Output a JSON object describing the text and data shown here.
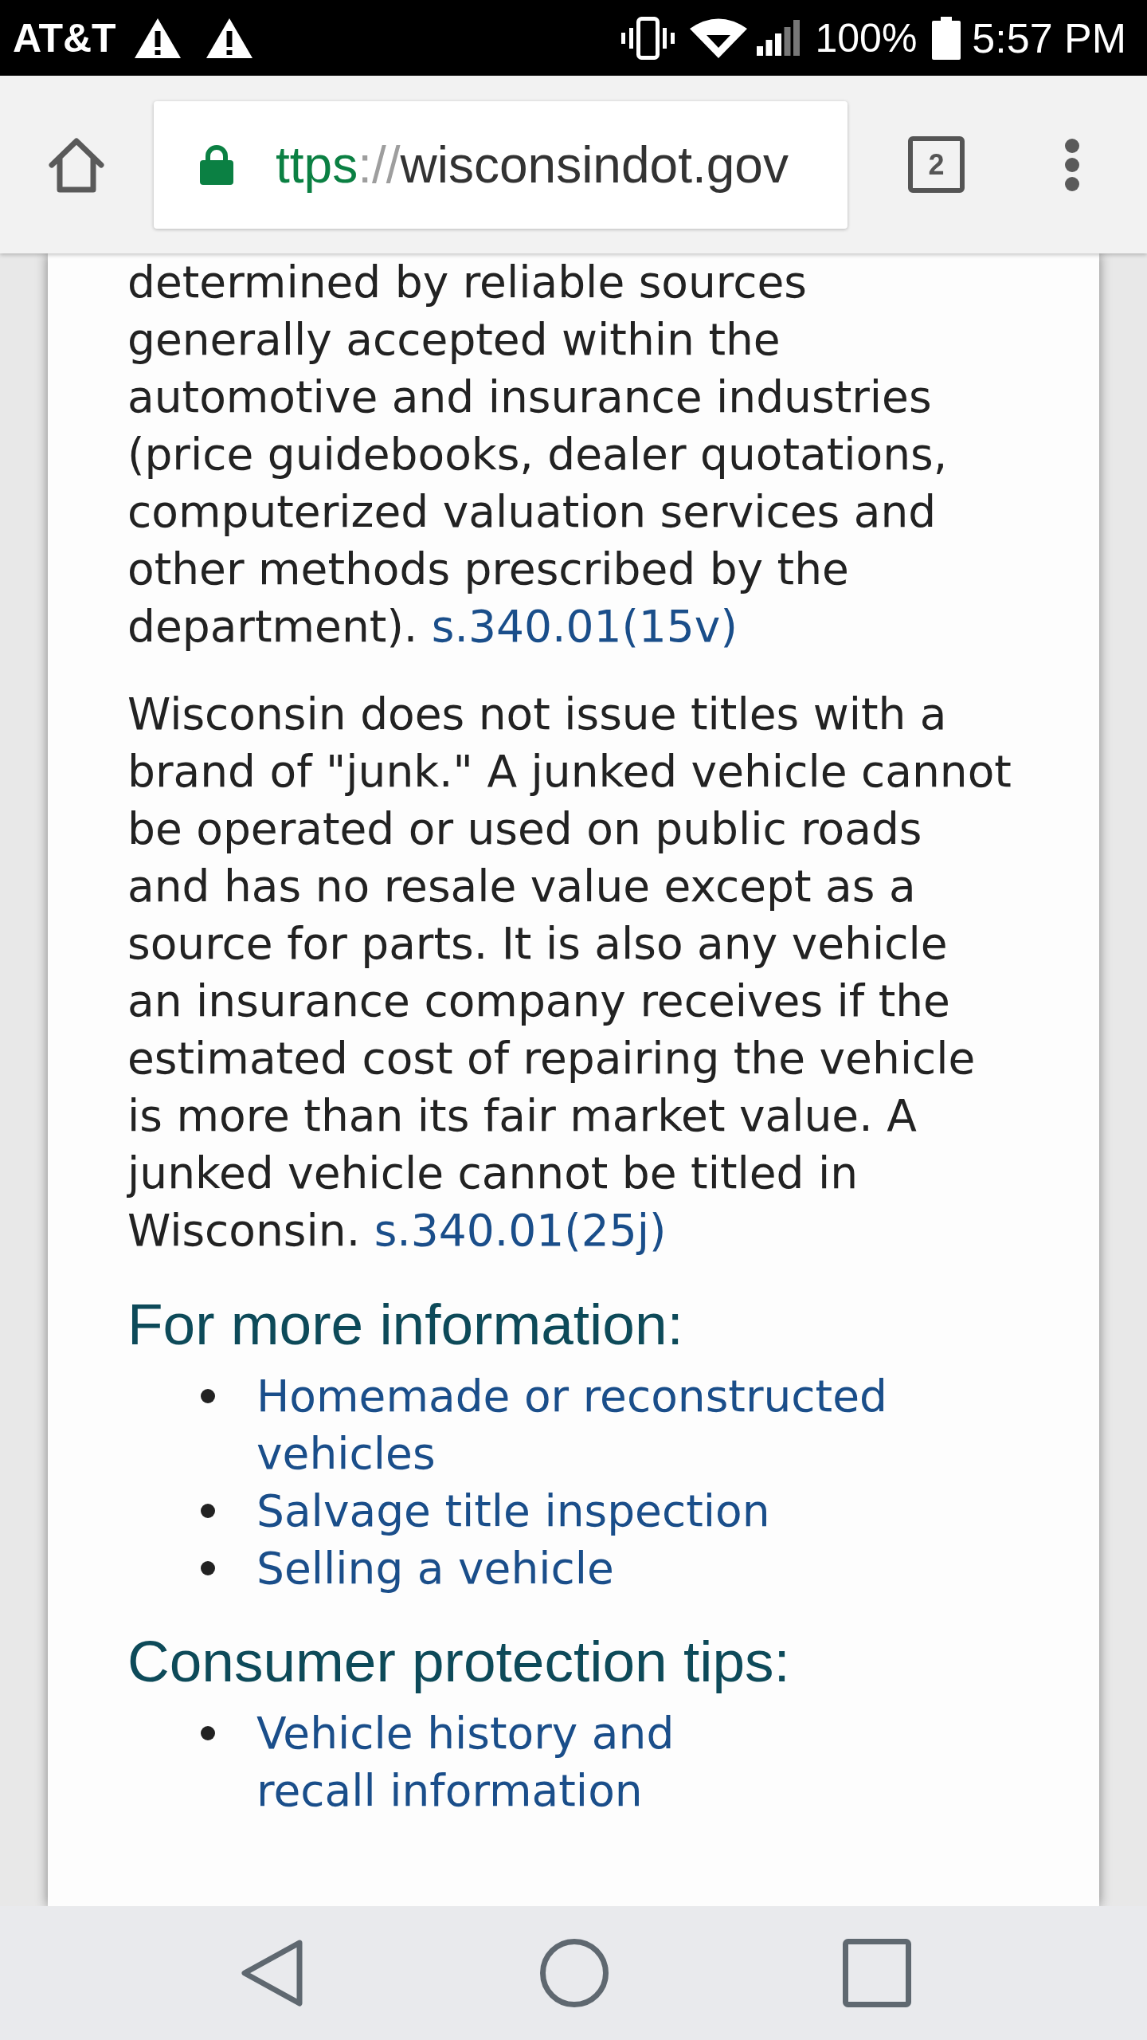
{
  "status_bar": {
    "carrier": "AT&T",
    "notifications": [
      {
        "kind": "warning"
      },
      {
        "kind": "warning"
      }
    ],
    "battery": "100%",
    "time": "5:57 PM"
  },
  "toolbar": {
    "address": {
      "secure": true,
      "scheme": "ttps",
      "separator": "://",
      "host": "wisconsindot.gov"
    },
    "tab_count": "2"
  },
  "article": {
    "paragraphs": [
      {
        "text": "determined by reliable sources generally accepted within the automotive and insurance industries (price guidebooks, dealer quotations, computerized valuation services and other methods prescribed by the department).",
        "link": "s.340.01(15v)"
      },
      {
        "text": "Wisconsin does not issue titles with a brand of \"junk.\" A junked vehicle cannot be operated or used on public roads and has no resale value except as a source for parts. It is also any vehicle an insurance company receives if the estimated cost of repairing the vehicle is more than its fair market value. A junked vehicle cannot be titled in Wisconsin.",
        "link": "s.340.01(25j)"
      }
    ],
    "sections": [
      {
        "heading": "For more information:",
        "links": [
          "Homemade or reconstructed vehicles",
          "Salvage title inspection",
          "Selling a vehicle"
        ]
      },
      {
        "heading": "Consumer protection tips:",
        "links": [
          "Vehicle history and recall information"
        ]
      }
    ]
  }
}
